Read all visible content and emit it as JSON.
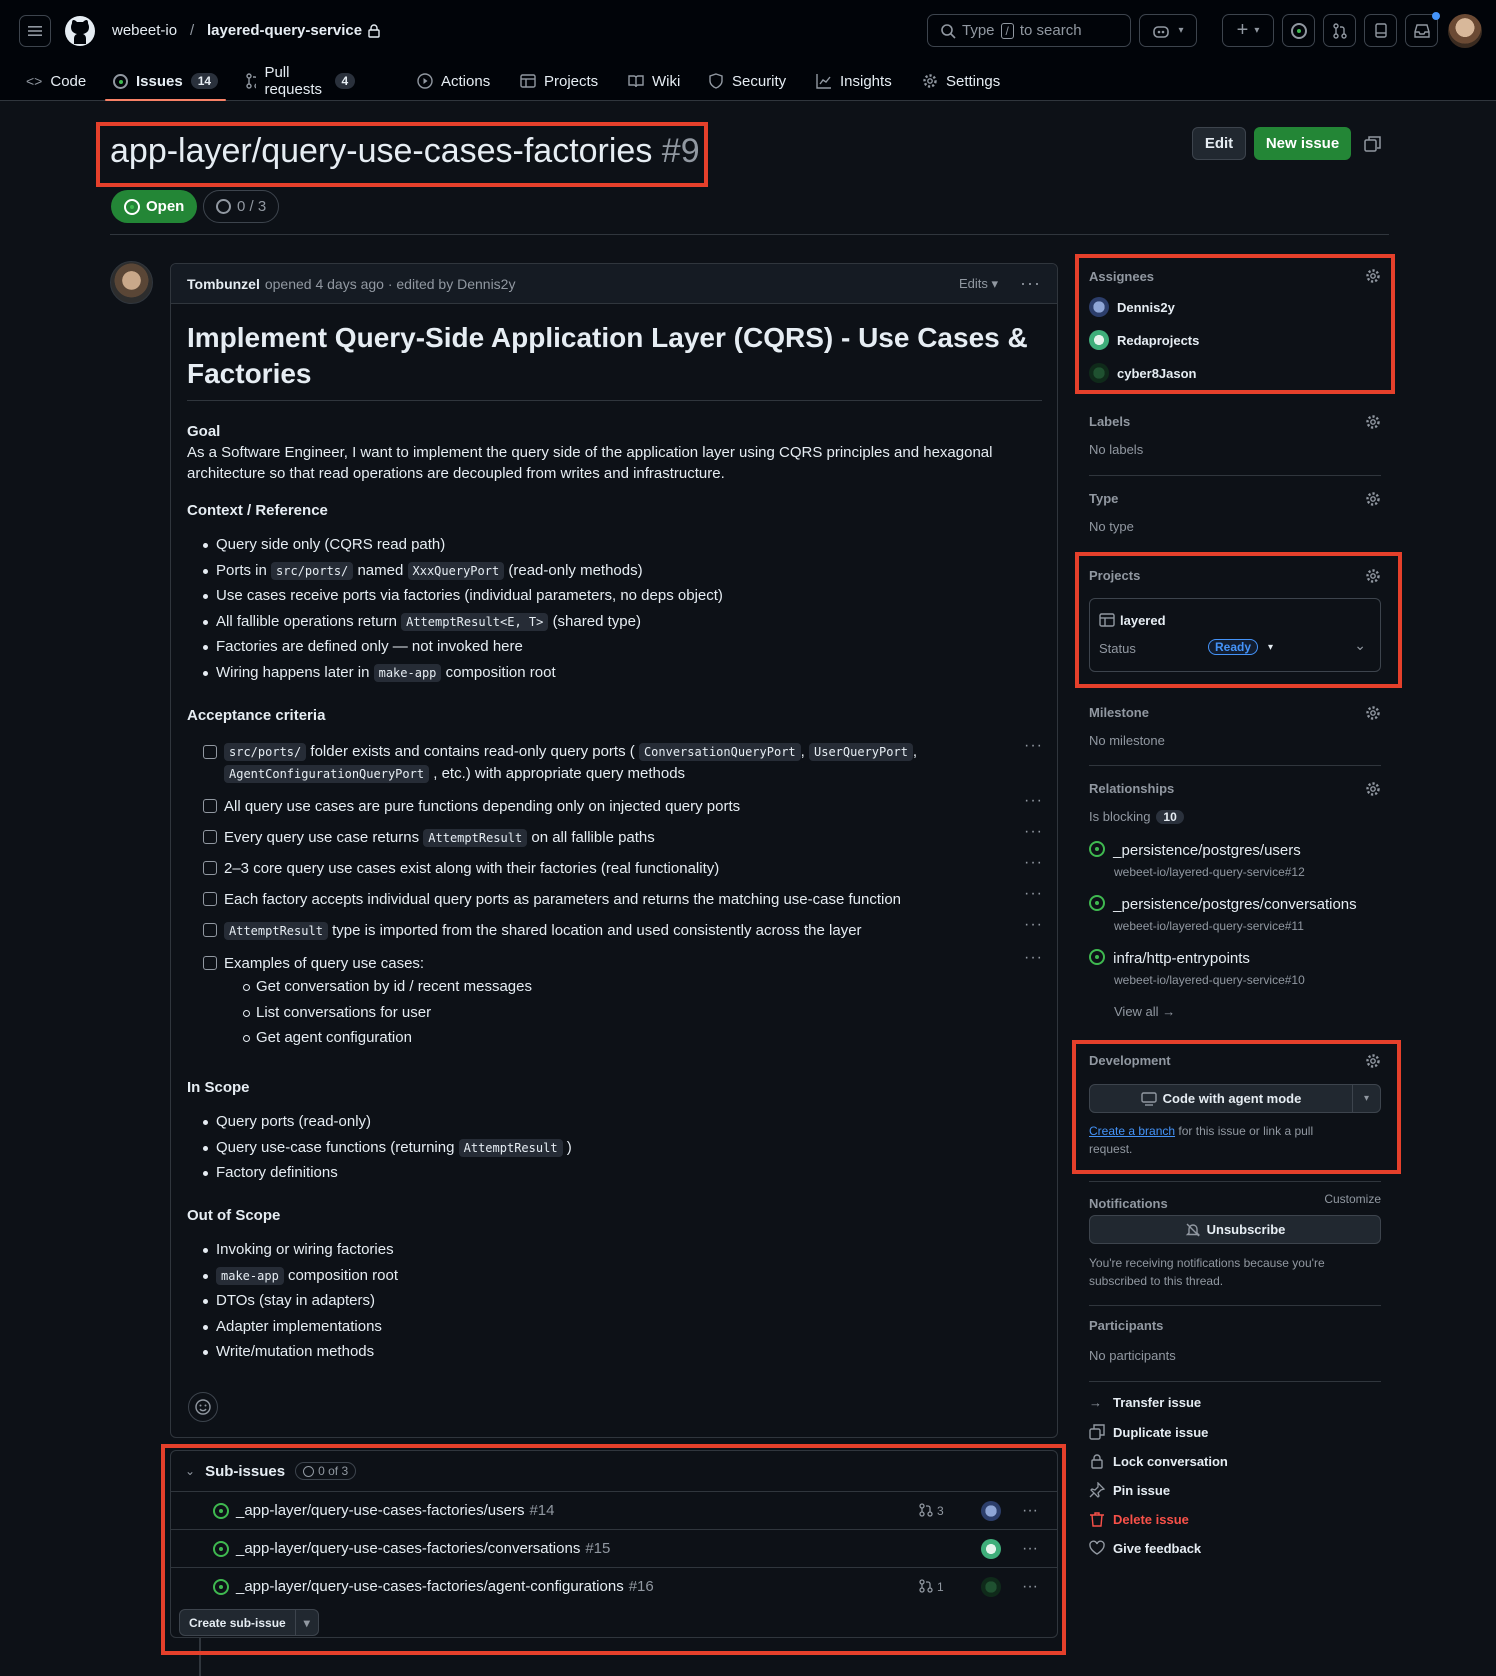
{
  "header": {
    "owner": "webeet-io",
    "separator": "/",
    "repo": "layered-query-service",
    "search_placeholder_pre": "Type",
    "search_key": "/",
    "search_placeholder_post": "to search"
  },
  "tabs": [
    {
      "label": "Code"
    },
    {
      "label": "Issues",
      "count": "14"
    },
    {
      "label": "Pull requests",
      "count": "4"
    },
    {
      "label": "Actions"
    },
    {
      "label": "Projects"
    },
    {
      "label": "Wiki"
    },
    {
      "label": "Security"
    },
    {
      "label": "Insights"
    },
    {
      "label": "Settings"
    }
  ],
  "issue": {
    "title": "app-layer/query-use-cases-factories",
    "number": "#9",
    "edit_label": "Edit",
    "new_issue_label": "New issue",
    "state": "Open",
    "progress": "0 / 3"
  },
  "comment": {
    "author": "Tombunzel",
    "meta": "opened 4 days ago · edited by Dennis2y",
    "edits_label": "Edits",
    "heading": "Implement Query-Side Application Layer (CQRS) - Use Cases & Factories",
    "goal_title": "Goal",
    "goal_text": "As a Software Engineer, I want to implement the query side of the application layer using CQRS principles and hexagonal architecture so that read operations are decoupled from writes and infrastructure.",
    "context_title": "Context / Reference",
    "context": {
      "c1": "Query side only (CQRS read path)",
      "c2a": "Ports in",
      "c2b": "src/ports/",
      "c2c": "named",
      "c2d": "XxxQueryPort",
      "c2e": "(read-only methods)",
      "c3": "Use cases receive ports via factories (individual parameters, no deps object)",
      "c4a": "All fallible operations return",
      "c4b": "AttemptResult<E, T>",
      "c4c": "(shared type)",
      "c5": "Factories are defined only — not invoked here",
      "c6a": "Wiring happens later in",
      "c6b": "make-app",
      "c6c": "composition root"
    },
    "acceptance_title": "Acceptance criteria",
    "acceptance": {
      "a1a": "src/ports/",
      "a1b": "folder exists and contains read-only query ports (",
      "a1c": "ConversationQueryPort",
      "a1d": ",",
      "a1e": "UserQueryPort",
      "a1f": ",",
      "a1g": "AgentConfigurationQueryPort",
      "a1h": ", etc.) with appropriate query methods",
      "a2": "All query use cases are pure functions depending only on injected query ports",
      "a3a": "Every query use case returns",
      "a3b": "AttemptResult",
      "a3c": "on all fallible paths",
      "a4": "2–3 core query use cases exist along with their factories (real functionality)",
      "a5": "Each factory accepts individual query ports as parameters and returns the matching use-case function",
      "a6a": "AttemptResult",
      "a6b": "type is imported from the shared location and used consistently across the layer",
      "a7": "Examples of query use cases:",
      "e1": "Get conversation by id / recent messages",
      "e2": "List conversations for user",
      "e3": "Get agent configuration"
    },
    "inscope_title": "In Scope",
    "inscope": {
      "i1": "Query ports (read-only)",
      "i2a": "Query use-case functions (returning",
      "i2b": "AttemptResult",
      "i2c": ")",
      "i3": "Factory definitions"
    },
    "outscope_title": "Out of Scope",
    "outscope": {
      "o1": "Invoking or wiring factories",
      "o2a": "make-app",
      "o2b": "composition root",
      "o3": "DTOs (stay in adapters)",
      "o4": "Adapter implementations",
      "o5": "Write/mutation methods"
    }
  },
  "sub_issues": {
    "title": "Sub-issues",
    "count": "0 of 3",
    "items": [
      {
        "title": "_app-layer/query-use-cases-factories/users",
        "num": "#14",
        "prs": "3"
      },
      {
        "title": "_app-layer/query-use-cases-factories/conversations",
        "num": "#15",
        "prs": ""
      },
      {
        "title": "_app-layer/query-use-cases-factories/agent-configurations",
        "num": "#16",
        "prs": "1"
      }
    ],
    "create_label": "Create sub-issue"
  },
  "sidebar": {
    "assignees_title": "Assignees",
    "assignees": [
      "Dennis2y",
      "Redaprojects",
      "cyber8Jason"
    ],
    "labels_title": "Labels",
    "labels_value": "No labels",
    "type_title": "Type",
    "type_value": "No type",
    "projects_title": "Projects",
    "project_name": "layered",
    "status_label": "Status",
    "status_value": "Ready",
    "milestone_title": "Milestone",
    "milestone_value": "No milestone",
    "relationships_title": "Relationships",
    "blocking_label": "Is blocking",
    "blocking_count": "10",
    "relations": [
      {
        "title": "_persistence/postgres/users",
        "ref": "webeet-io/layered-query-service#12"
      },
      {
        "title": "_persistence/postgres/conversations",
        "ref": "webeet-io/layered-query-service#11"
      },
      {
        "title": "infra/http-entrypoints",
        "ref": "webeet-io/layered-query-service#10"
      }
    ],
    "view_all": "View all",
    "development_title": "Development",
    "agent_button": "Code with agent mode",
    "create_branch": "Create a branch",
    "dev_note": "for this issue or link a pull request.",
    "notifications_title": "Notifications",
    "customize": "Customize",
    "unsubscribe": "Unsubscribe",
    "notif_note": "You're receiving notifications because you're subscribed to this thread.",
    "participants_title": "Participants",
    "participants_value": "No participants",
    "actions": [
      "Transfer issue",
      "Duplicate issue",
      "Lock conversation",
      "Pin issue",
      "Delete issue",
      "Give feedback"
    ]
  },
  "colors": {
    "open_green": "#238636",
    "accent_red": "#e5402b",
    "link_blue": "#4493f8",
    "danger": "#f85149"
  }
}
